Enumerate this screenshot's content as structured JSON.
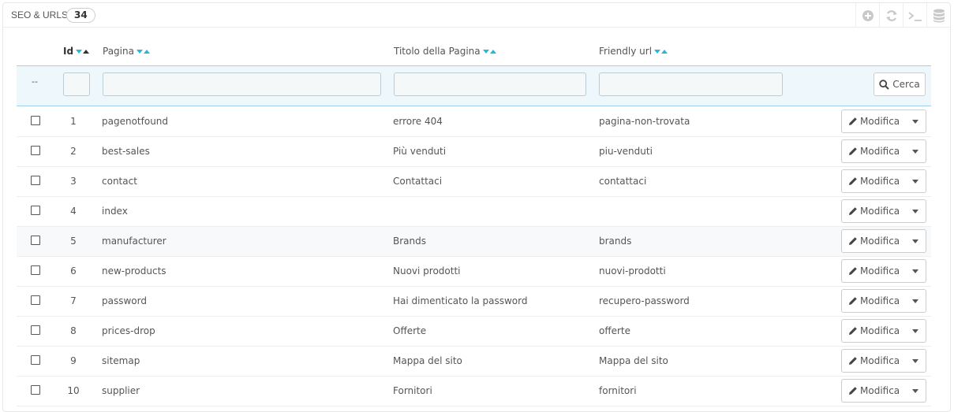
{
  "panel": {
    "title": "SEO & URLS",
    "count": "34",
    "toolbar": [
      {
        "icon": "add-icon"
      },
      {
        "icon": "refresh-icon"
      },
      {
        "icon": "sql-query-icon"
      },
      {
        "icon": "database-export-icon"
      }
    ]
  },
  "columns": {
    "id": "Id",
    "page": "Pagina",
    "title": "Titolo della Pagina",
    "url": "Friendly url"
  },
  "filters": {
    "bulk_dash": "--",
    "search_label": "Cerca"
  },
  "row_action_label": "Modifica",
  "rows": [
    {
      "id": "1",
      "page": "pagenotfound",
      "title": "errore 404",
      "url": "pagina-non-trovata"
    },
    {
      "id": "2",
      "page": "best-sales",
      "title": "Più venduti",
      "url": "piu-venduti"
    },
    {
      "id": "3",
      "page": "contact",
      "title": "Contattaci",
      "url": "contattaci"
    },
    {
      "id": "4",
      "page": "index",
      "title": "",
      "url": ""
    },
    {
      "id": "5",
      "page": "manufacturer",
      "title": "Brands",
      "url": "brands"
    },
    {
      "id": "6",
      "page": "new-products",
      "title": "Nuovi prodotti",
      "url": "nuovi-prodotti"
    },
    {
      "id": "7",
      "page": "password",
      "title": "Hai dimenticato la password",
      "url": "recupero-password"
    },
    {
      "id": "8",
      "page": "prices-drop",
      "title": "Offerte",
      "url": "offerte"
    },
    {
      "id": "9",
      "page": "sitemap",
      "title": "Mappa del sito",
      "url": "Mappa del sito"
    },
    {
      "id": "10",
      "page": "supplier",
      "title": "Fornitori",
      "url": "fornitori"
    }
  ],
  "colors": {
    "accent": "#25b9d7",
    "filter_bg": "#eef7fb",
    "filter_border": "#a0d0eb"
  }
}
